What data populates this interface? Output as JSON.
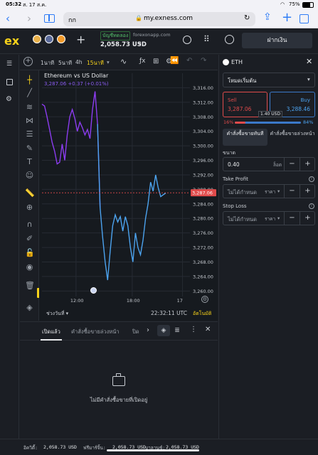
{
  "status_bar": {
    "time": "05:32",
    "date": "ส. 17 ส.ค.",
    "battery": "75%"
  },
  "browser": {
    "aa_label": "กก",
    "url": "my.exness.com"
  },
  "header": {
    "logo": "ex",
    "account_type": "บัญชีทดลอง",
    "server": "forexonapp.com",
    "balance": "2,058.73 USD",
    "deposit_label": "ฝากเงิน"
  },
  "chart_toolbar": {
    "timeframes": [
      "1นาที",
      "5นาที",
      "4h",
      "15นาที"
    ],
    "active_timeframe": "15นาที"
  },
  "chart": {
    "symbol_title": "Ethereum vs US Dollar",
    "quote_line": "3,287.06 +0.37 (+0.01%)",
    "current_price_label": "3,287.06",
    "date_range_label": "ช่วงวันที่",
    "clock": "22:32:11 UTC",
    "auto_label": "อัตโนมัติ",
    "colors": {
      "up": "#4ca3ef",
      "down": "#8c3cf0",
      "price_line": "#e04b4b"
    }
  },
  "chart_data": {
    "type": "line",
    "title": "Ethereum vs US Dollar",
    "y_ticks": [
      3316,
      3312,
      3308,
      3304,
      3300,
      3296,
      3292,
      3288,
      3284,
      3280,
      3276,
      3272,
      3268,
      3264,
      3260
    ],
    "y_tick_labels": [
      "3,316.00",
      "3,312.00",
      "3,308.00",
      "3,304.00",
      "3,300.00",
      "3,296.00",
      "3,292.00",
      "3,288.00",
      "3,284.00",
      "3,280.00",
      "3,276.00",
      "3,272.00",
      "3,268.00",
      "3,264.00",
      "3,260.00"
    ],
    "ylim": [
      3258.5,
      3320
    ],
    "x_ticks": [
      "12:00",
      "18:00",
      "17"
    ],
    "x_tick_pos": [
      0.23,
      0.61,
      0.95
    ],
    "series": [
      {
        "values": [
          3311.5,
          3311.0,
          3308.0,
          3304.5,
          3301.0,
          3298.5,
          3295.0,
          3295.5,
          3300.5,
          3296.0,
          3303.0,
          3308.0,
          3310.0,
          3307.5,
          3304.0,
          3306.5,
          3305.0,
          3303.0,
          3304.5,
          3302.0,
          3310.0,
          3315.0,
          3306.0,
          3283.0,
          3275.0,
          3268.0,
          3263.0,
          3271.0,
          3278.0,
          3281.0,
          3279.0,
          3280.5,
          3276.5,
          3280.5,
          3278.0,
          3272.0,
          3268.0,
          3276.0,
          3272.0,
          3270.0,
          3274.0,
          3280.0,
          3284.0,
          3290.0,
          3287.5,
          3292.0,
          3288.5,
          3286.0,
          3286.5,
          3287.0
        ]
      }
    ],
    "current_price": 3287.06,
    "grid": true
  },
  "order_panel": {
    "symbol": "ETH",
    "mode": "โหมดเริ่มต้น",
    "sell_label": "Sell",
    "sell_price": "3,287.06",
    "buy_label": "Buy",
    "buy_price": "3,288.46",
    "spread": "1.40 USD",
    "sell_pct": "16%",
    "buy_pct": "84%",
    "sell_pct_value": 0.16,
    "tab_instant": "คำสั่งซื้อขายทันที",
    "tab_pending": "คำสั่งซื้อขายล่วงหน้า",
    "volume_label": "ขนาด",
    "volume_value": "0.40",
    "volume_unit": "ล็อต",
    "tp_label": "Take Profit",
    "tp_placeholder": "ไม่ได้กำหนด",
    "tp_unit": "ราคา",
    "sl_label": "Stop Loss",
    "sl_placeholder": "ไม่ได้กำหนด",
    "sl_unit": "ราคา"
  },
  "bottom_panel": {
    "tabs": [
      "เปิดแล้ว",
      "คำสั่งซื้อขายล่วงหน้า",
      "ปิด"
    ],
    "active_tab": "เปิดแล้ว",
    "empty_message": "ไม่มีคำสั่งซื้อขายที่เปิดอยู่"
  },
  "footer": {
    "equity_label": "อิควิตี้:",
    "equity_value": "2,058.73 USD",
    "free_margin_label": "ฟรีมาร์จิ้น:",
    "free_margin_value": "2,058.73 USD",
    "balance_label": "บาลานซ์:",
    "balance_value": "2,058.73 USD"
  }
}
